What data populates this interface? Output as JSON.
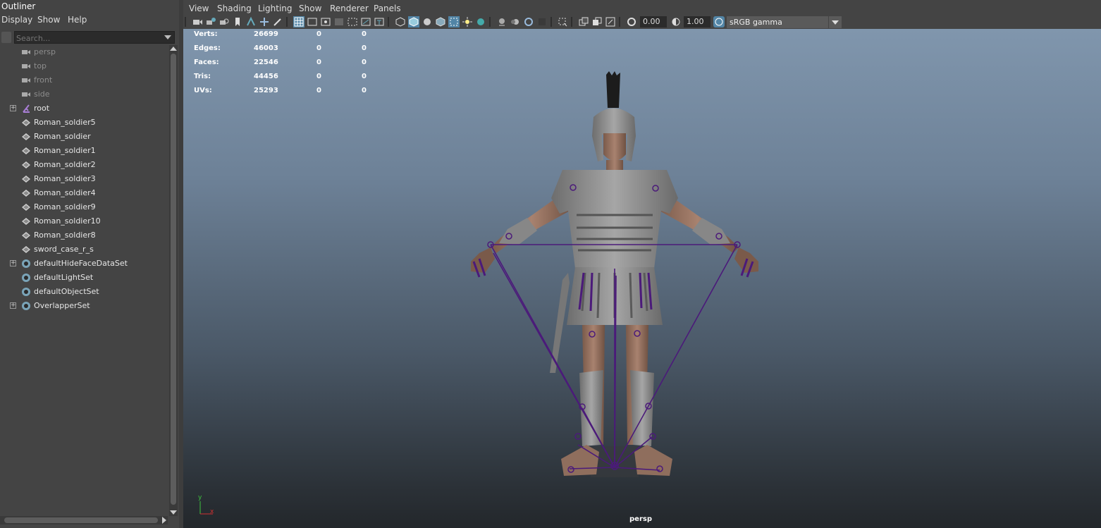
{
  "outliner": {
    "title": "Outliner",
    "menu": [
      "Display",
      "Show",
      "Help"
    ],
    "search_placeholder": "Search...",
    "items": [
      {
        "label": "persp",
        "icon": "camera-icon",
        "expandable": false,
        "dim": true
      },
      {
        "label": "top",
        "icon": "camera-icon",
        "expandable": false,
        "dim": true
      },
      {
        "label": "front",
        "icon": "camera-icon",
        "expandable": false,
        "dim": true
      },
      {
        "label": "side",
        "icon": "camera-icon",
        "expandable": false,
        "dim": true
      },
      {
        "label": "root",
        "icon": "joint-icon",
        "expandable": true,
        "dim": false
      },
      {
        "label": "Roman_soldier5",
        "icon": "mesh-icon",
        "expandable": false,
        "dim": false
      },
      {
        "label": "Roman_soldier",
        "icon": "mesh-icon",
        "expandable": false,
        "dim": false
      },
      {
        "label": "Roman_soldier1",
        "icon": "mesh-icon",
        "expandable": false,
        "dim": false
      },
      {
        "label": "Roman_soldier2",
        "icon": "mesh-icon",
        "expandable": false,
        "dim": false
      },
      {
        "label": "Roman_soldier3",
        "icon": "mesh-icon",
        "expandable": false,
        "dim": false
      },
      {
        "label": "Roman_soldier4",
        "icon": "mesh-icon",
        "expandable": false,
        "dim": false
      },
      {
        "label": "Roman_soldier9",
        "icon": "mesh-icon",
        "expandable": false,
        "dim": false
      },
      {
        "label": "Roman_soldier10",
        "icon": "mesh-icon",
        "expandable": false,
        "dim": false
      },
      {
        "label": "Roman_soldier8",
        "icon": "mesh-icon",
        "expandable": false,
        "dim": false
      },
      {
        "label": "sword_case_r_s",
        "icon": "mesh-icon",
        "expandable": false,
        "dim": false
      },
      {
        "label": "defaultHideFaceDataSet",
        "icon": "set-icon",
        "expandable": true,
        "dim": false
      },
      {
        "label": "defaultLightSet",
        "icon": "set-icon",
        "expandable": false,
        "dim": false
      },
      {
        "label": "defaultObjectSet",
        "icon": "set-icon",
        "expandable": false,
        "dim": false
      },
      {
        "label": "OverlapperSet",
        "icon": "set-icon",
        "expandable": true,
        "dim": false
      }
    ]
  },
  "panel": {
    "menu": [
      "View",
      "Shading",
      "Lighting",
      "Show",
      "Renderer",
      "Panels"
    ],
    "exposure": "0.00",
    "gamma": "1.00",
    "color_space": "sRGB gamma",
    "camera": "persp"
  },
  "hud": {
    "rows": [
      {
        "label": "Verts:",
        "v1": "26699",
        "v2": "0",
        "v3": "0"
      },
      {
        "label": "Edges:",
        "v1": "46003",
        "v2": "0",
        "v3": "0"
      },
      {
        "label": "Faces:",
        "v1": "22546",
        "v2": "0",
        "v3": "0"
      },
      {
        "label": "Tris:",
        "v1": "44456",
        "v2": "0",
        "v3": "0"
      },
      {
        "label": "UVs:",
        "v1": "25293",
        "v2": "0",
        "v3": "0"
      }
    ]
  },
  "axis": {
    "x": "x",
    "y": "y"
  },
  "colors": {
    "accent": "#5285a6",
    "joint": "#4b1a7a",
    "viewport_top": "#8096ad",
    "viewport_bottom": "#23272b"
  }
}
